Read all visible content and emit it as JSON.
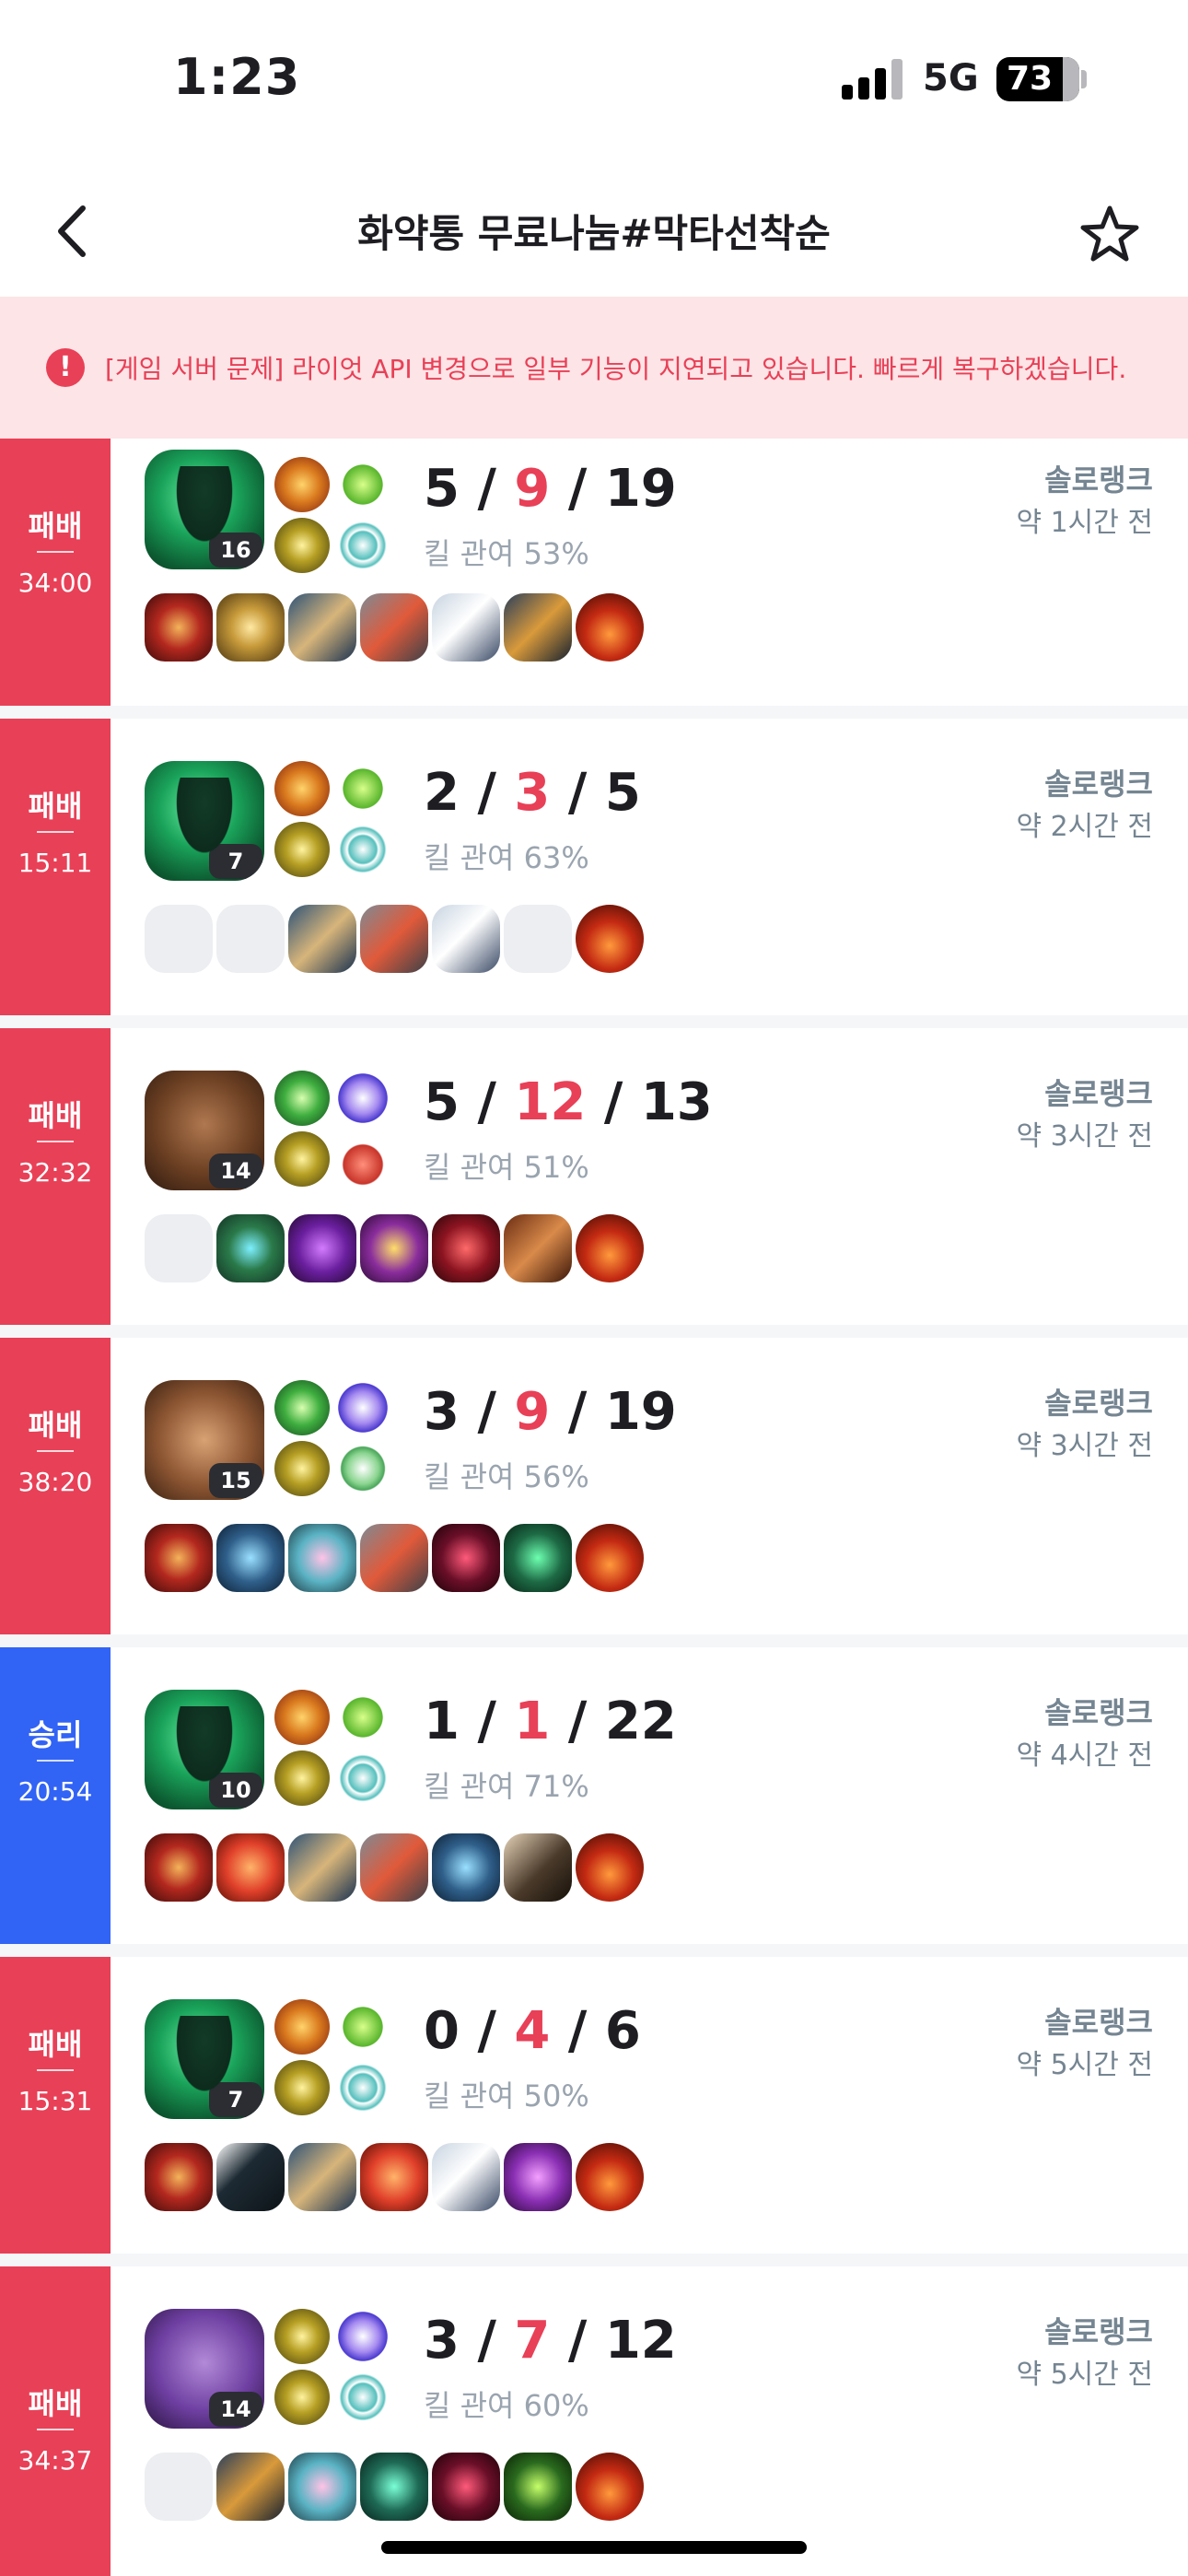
{
  "status": {
    "time": "1:23",
    "network": "5G",
    "battery": "73",
    "battery_level_pct": 73
  },
  "header": {
    "title": "화약통 무료나눔#막타선착순",
    "back_icon": "chevron-left-icon",
    "favorite_icon": "star-icon"
  },
  "notice": {
    "icon": "!",
    "text": "[게임 서버 문제] 라이엇 API 변경으로 일부 기능이 지연되고 있습니다. 빠르게 복구하겠습니다."
  },
  "colors": {
    "loss": "#e84057",
    "win": "#3163f5",
    "notice_bg": "#fde4e6"
  },
  "matches": [
    {
      "result": "패배",
      "duration": "34:00",
      "level": "16",
      "kills": "5",
      "deaths": "9",
      "assists": "19",
      "kill_participation": "킬 관여 53%",
      "queue": "솔로랭크",
      "ago": "약 1시간 전"
    },
    {
      "result": "패배",
      "duration": "15:11",
      "level": "7",
      "kills": "2",
      "deaths": "3",
      "assists": "5",
      "kill_participation": "킬 관여 63%",
      "queue": "솔로랭크",
      "ago": "약 2시간 전"
    },
    {
      "result": "패배",
      "duration": "32:32",
      "level": "14",
      "kills": "5",
      "deaths": "12",
      "assists": "13",
      "kill_participation": "킬 관여 51%",
      "queue": "솔로랭크",
      "ago": "약 3시간 전"
    },
    {
      "result": "패배",
      "duration": "38:20",
      "level": "15",
      "kills": "3",
      "deaths": "9",
      "assists": "19",
      "kill_participation": "킬 관여 56%",
      "queue": "솔로랭크",
      "ago": "약 3시간 전"
    },
    {
      "result": "승리",
      "duration": "20:54",
      "level": "10",
      "kills": "1",
      "deaths": "1",
      "assists": "22",
      "kill_participation": "킬 관여 71%",
      "queue": "솔로랭크",
      "ago": "약 4시간 전"
    },
    {
      "result": "패배",
      "duration": "15:31",
      "level": "7",
      "kills": "0",
      "deaths": "4",
      "assists": "6",
      "kill_participation": "킬 관여 50%",
      "queue": "솔로랭크",
      "ago": "약 5시간 전"
    },
    {
      "result": "패배",
      "duration": "34:37",
      "level": "14",
      "kills": "3",
      "deaths": "7",
      "assists": "12",
      "kill_participation": "킬 관여 60%",
      "queue": "솔로랭크",
      "ago": "약 5시간 전"
    }
  ],
  "slash": "/"
}
